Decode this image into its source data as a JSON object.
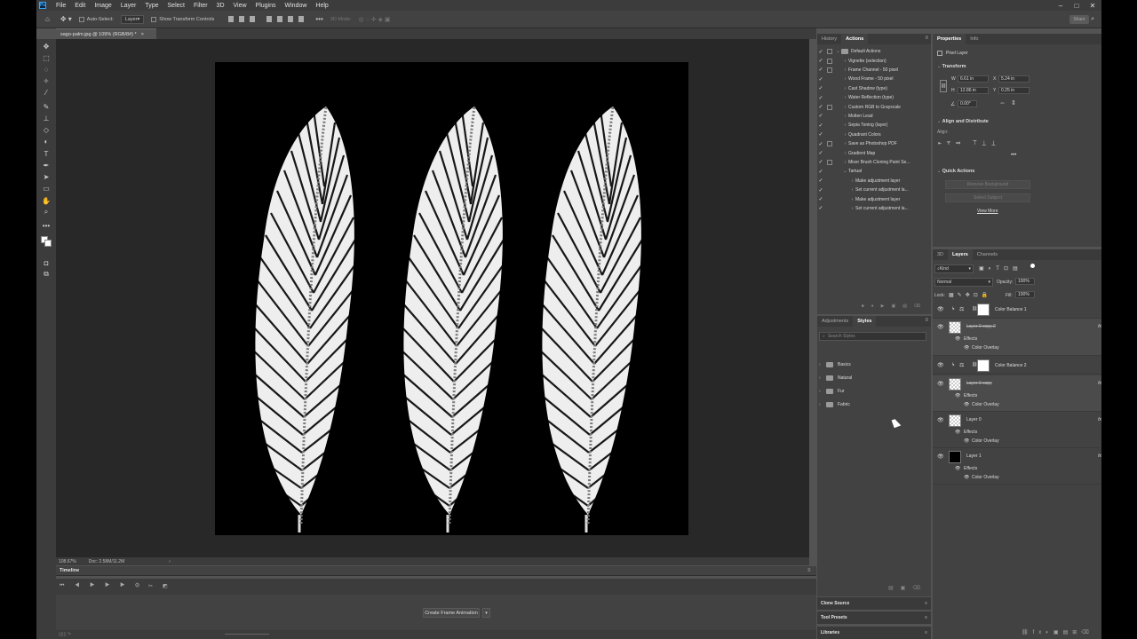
{
  "menubar": {
    "app_icon": "Ps",
    "items": [
      "File",
      "Edit",
      "Image",
      "Layer",
      "Type",
      "Select",
      "Filter",
      "3D",
      "View",
      "Plugins",
      "Window",
      "Help"
    ]
  },
  "options": {
    "auto_select": "Auto-Select:",
    "layer_select": "Layer",
    "show_transform": "Show Transform Controls",
    "mode_3d": "3D Mode:",
    "share": "Share"
  },
  "document": {
    "tab_title": "sago-palm.jpg @ 109% (RGB/8#) *",
    "zoom": "108.67%",
    "doc_info": "Doc: 2.58M/11.2M"
  },
  "timeline": {
    "title": "Timeline",
    "create_button": "Create Frame Animation"
  },
  "actions_panel": {
    "tabs": [
      "History",
      "Actions"
    ],
    "items": [
      {
        "label": "Default Actions",
        "level": 0,
        "folder": true,
        "open": true,
        "dialog": true
      },
      {
        "label": "Vignette (selection)",
        "level": 1,
        "dialog": true
      },
      {
        "label": "Frame Channel - 50 pixel",
        "level": 1,
        "dialog": true
      },
      {
        "label": "Wood Frame - 50 pixel",
        "level": 1,
        "dialog": false
      },
      {
        "label": "Cast Shadow (type)",
        "level": 1,
        "dialog": false
      },
      {
        "label": "Water Reflection (type)",
        "level": 1,
        "dialog": false
      },
      {
        "label": "Custom RGB to Grayscale",
        "level": 1,
        "dialog": true
      },
      {
        "label": "Molten Lead",
        "level": 1,
        "dialog": false
      },
      {
        "label": "Sepia Toning (layer)",
        "level": 1,
        "dialog": false
      },
      {
        "label": "Quadrant Colors",
        "level": 1,
        "dialog": false
      },
      {
        "label": "Save as Photoshop PDF",
        "level": 1,
        "dialog": true
      },
      {
        "label": "Gradient Map",
        "level": 1,
        "dialog": false
      },
      {
        "label": "Mixer Brush Cloning Paint Se...",
        "level": 1,
        "dialog": true
      },
      {
        "label": "Tartual",
        "level": 1,
        "open": true,
        "dialog": false
      },
      {
        "label": "Make adjustment layer",
        "level": 2,
        "dialog": false
      },
      {
        "label": "Set current adjustment la...",
        "level": 2,
        "dialog": false
      },
      {
        "label": "Make adjustment layer",
        "level": 2,
        "dialog": false
      },
      {
        "label": "Set current adjustment la...",
        "level": 2,
        "dialog": false
      }
    ]
  },
  "styles_panel": {
    "tabs": [
      "Adjustments",
      "Styles"
    ],
    "search_placeholder": "Search Styles",
    "folders": [
      "Basics",
      "Natural",
      "Fur",
      "Fabric"
    ]
  },
  "collapsed_panels": [
    "Clone Source",
    "Tool Presets",
    "Libraries"
  ],
  "properties": {
    "tabs": [
      "Properties",
      "Info"
    ],
    "kind": "Pixel Layer",
    "transform_title": "Transform",
    "w_label": "W",
    "w": "6.61 in",
    "h_label": "H",
    "h": "12.86 in",
    "x_label": "X",
    "x": "5.24 in",
    "y_label": "Y",
    "y": "0.25 in",
    "angle": "0.00°",
    "align_title": "Align and Distribute",
    "align_label": "Align:",
    "quick_actions_title": "Quick Actions",
    "remove_bg": "Remove Background",
    "select_subject": "Select Subject",
    "view_more": "View More"
  },
  "layers_panel": {
    "tabs": [
      "3D",
      "Layers",
      "Channels"
    ],
    "filter_kind": "Kind",
    "blend_mode": "Normal",
    "opacity_label": "Opacity:",
    "opacity": "100%",
    "lock_label": "Lock:",
    "fill_label": "Fill:",
    "fill": "100%",
    "layers": [
      {
        "name": "Color Balance 1",
        "type": "adjustment",
        "effects": []
      },
      {
        "name": "Layer 0 copy 2",
        "type": "pixel",
        "hidden_text": true,
        "selected": true,
        "effects": [
          "Color Overlay"
        ]
      },
      {
        "name": "Color Balance 2",
        "type": "adjustment",
        "effects": []
      },
      {
        "name": "Layer 0 copy",
        "type": "pixel",
        "hidden_text": true,
        "selected": true,
        "effects": [
          "Color Overlay"
        ]
      },
      {
        "name": "Layer 0",
        "type": "pixel",
        "effects": [
          "Color Overlay"
        ]
      },
      {
        "name": "Layer 1",
        "type": "black",
        "effects": [
          "Color Overlay"
        ]
      }
    ],
    "effects_label": "Effects",
    "fx_label": "fx"
  }
}
